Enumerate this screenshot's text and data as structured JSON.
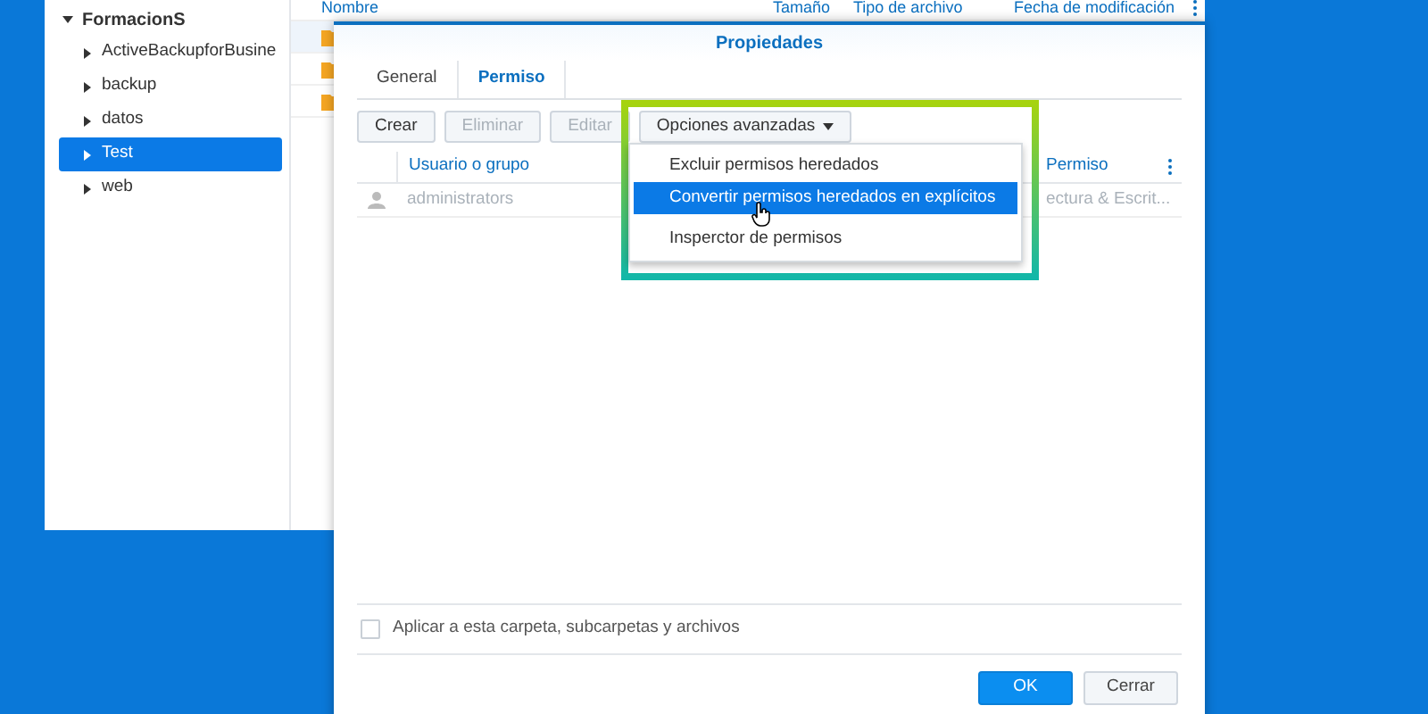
{
  "file_manager": {
    "tree": {
      "label": "FormacionS",
      "expanded": true,
      "children": [
        {
          "label": "ActiveBackupforBusine",
          "selected": false
        },
        {
          "label": "backup",
          "selected": false
        },
        {
          "label": "datos",
          "selected": false
        },
        {
          "label": "Test",
          "selected": true
        },
        {
          "label": "web",
          "selected": false
        }
      ]
    },
    "columns": [
      "Nombre",
      "Tamaño",
      "Tipo de archivo",
      "Fecha de modificación"
    ]
  },
  "dialog": {
    "title": "Propiedades",
    "tabs": [
      {
        "label": "General",
        "selected": false
      },
      {
        "label": "Permiso",
        "selected": true
      }
    ],
    "toolbar": [
      {
        "label": "Crear",
        "disabled": false
      },
      {
        "label": "Eliminar",
        "disabled": true
      },
      {
        "label": "Editar",
        "disabled": true
      }
    ],
    "advanced_menu": {
      "label": "Opciones avanzadas",
      "items": [
        {
          "label": "Excluir permisos heredados",
          "selected": false
        },
        {
          "label": "Convertir permisos heredados en explícitos",
          "selected": true
        },
        {
          "label": "Insperctor de permisos",
          "selected": false
        }
      ]
    },
    "table": {
      "columns": [
        "Usuario o grupo",
        "Permiso"
      ],
      "rows": [
        {
          "user": "administrators",
          "permission": "ectura & Escrit..."
        }
      ]
    },
    "apply_checkbox": {
      "label": "Aplicar a esta carpeta, subcarpetas y archivos",
      "checked": false
    },
    "buttons": [
      {
        "label": "OK",
        "kind": "primary"
      },
      {
        "label": "Cerrar",
        "kind": "secondary"
      }
    ]
  }
}
